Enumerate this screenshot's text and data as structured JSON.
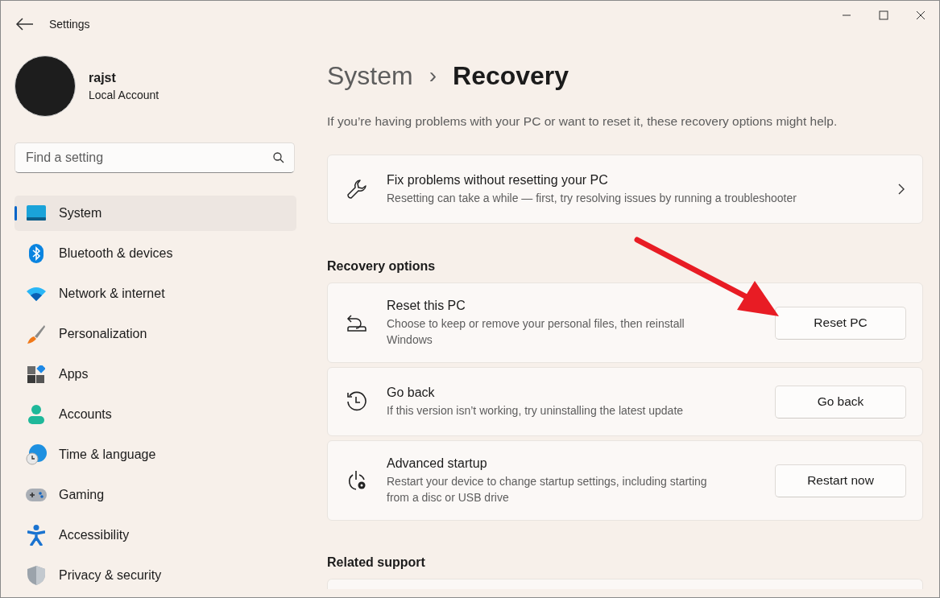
{
  "window": {
    "title": "Settings"
  },
  "account": {
    "name": "rajst",
    "type": "Local Account"
  },
  "search": {
    "placeholder": "Find a setting"
  },
  "sidebar": {
    "items": [
      {
        "label": "System",
        "selected": true
      },
      {
        "label": "Bluetooth & devices",
        "selected": false
      },
      {
        "label": "Network & internet",
        "selected": false
      },
      {
        "label": "Personalization",
        "selected": false
      },
      {
        "label": "Apps",
        "selected": false
      },
      {
        "label": "Accounts",
        "selected": false
      },
      {
        "label": "Time & language",
        "selected": false
      },
      {
        "label": "Gaming",
        "selected": false
      },
      {
        "label": "Accessibility",
        "selected": false
      },
      {
        "label": "Privacy & security",
        "selected": false
      }
    ]
  },
  "breadcrumb": {
    "parent": "System",
    "separator": "›",
    "current": "Recovery"
  },
  "description": "If you’re having problems with your PC or want to reset it, these recovery options might help.",
  "top_card": {
    "kind": "link",
    "title": "Fix problems without resetting your PC",
    "subtitle": "Resetting can take a while — first, try resolving issues by running a troubleshooter"
  },
  "sections": [
    {
      "heading": "Recovery options",
      "cards": [
        {
          "kind": "button",
          "title": "Reset this PC",
          "subtitle": "Choose to keep or remove your personal files, then reinstall Windows",
          "button": "Reset PC"
        },
        {
          "kind": "button",
          "title": "Go back",
          "subtitle": "If this version isn’t working, try uninstalling the latest update",
          "button": "Go back"
        },
        {
          "kind": "button",
          "title": "Advanced startup",
          "subtitle": "Restart your device to change startup settings, including starting from a disc or USB drive",
          "button": "Restart now"
        }
      ]
    },
    {
      "heading": "Related support"
    }
  ]
}
